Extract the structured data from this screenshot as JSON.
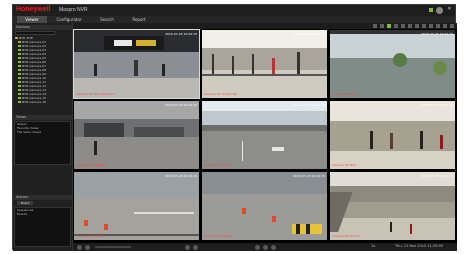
{
  "app": {
    "brand": "Honeywell",
    "product": "Maxpro NVR"
  },
  "tabs": [
    {
      "label": "Viewer",
      "active": true
    },
    {
      "label": "Configurator",
      "active": false
    },
    {
      "label": "Search",
      "active": false
    },
    {
      "label": "Report",
      "active": false
    }
  ],
  "header": {
    "user": "ADMIN",
    "date": "2015-07-23 10:02"
  },
  "sidebar": {
    "devices_header": "Devices",
    "tree": [
      "NVR SITE",
      "NVR-Camera-01",
      "NVR-Camera-02",
      "NVR-Camera-03",
      "NVR-Camera-04",
      "NVR-Camera-05",
      "NVR-Camera-06",
      "NVR-Camera-07",
      "NVR-Camera-08",
      "NVR-Camera-09",
      "NVR-Camera-10",
      "NVR-Camera-11",
      "NVR-Camera-12",
      "NVR-Camera-13",
      "NVR-Camera-14",
      "NVR-Camera-15",
      "NVR-Camera-16"
    ],
    "views_header": "Views",
    "views": [
      "Salvos",
      "Favorite Views",
      "Tile Salvo Views"
    ],
    "alarms_header": "Alarms",
    "alarms_tab": "Event",
    "alarms": [
      "Sequences",
      "Events"
    ]
  },
  "cameras": [
    {
      "label": "Camera 01 Main Entrance",
      "time": "2015-07-23 10:02:15",
      "scene": "metro"
    },
    {
      "label": "Camera 02 Ticket Hall",
      "time": "2015-07-23 10:02:15",
      "scene": "gates"
    },
    {
      "label": "Camera 03 Plaza",
      "time": "2015-07-23 10:02:15",
      "scene": "plaza"
    },
    {
      "label": "Camera 04 Baggage",
      "time": "2015-07-23 10:02:15",
      "scene": "baggage"
    },
    {
      "label": "Camera 05 Road",
      "time": "2015-07-23 10:02:15",
      "scene": "road"
    },
    {
      "label": "Camera 06 Mall",
      "time": "2015-07-23 10:02:15",
      "scene": "mall"
    },
    {
      "label": "Camera 07 Parking",
      "time": "2015-07-23 10:02:15",
      "scene": "parking"
    },
    {
      "label": "Camera 08 Garage",
      "time": "2015-07-23 10:02:15",
      "scene": "garage"
    },
    {
      "label": "Camera 09 Atrium",
      "time": "2015-07-23 10:02:15",
      "scene": "atrium"
    }
  ],
  "statusbar": {
    "date": "Thu, 21 Nov 2015 11:39:00",
    "zoom": "1x"
  },
  "colors": {
    "brand": "#e31e24",
    "accent_green": "#7bbd3f",
    "window": "#151515"
  }
}
